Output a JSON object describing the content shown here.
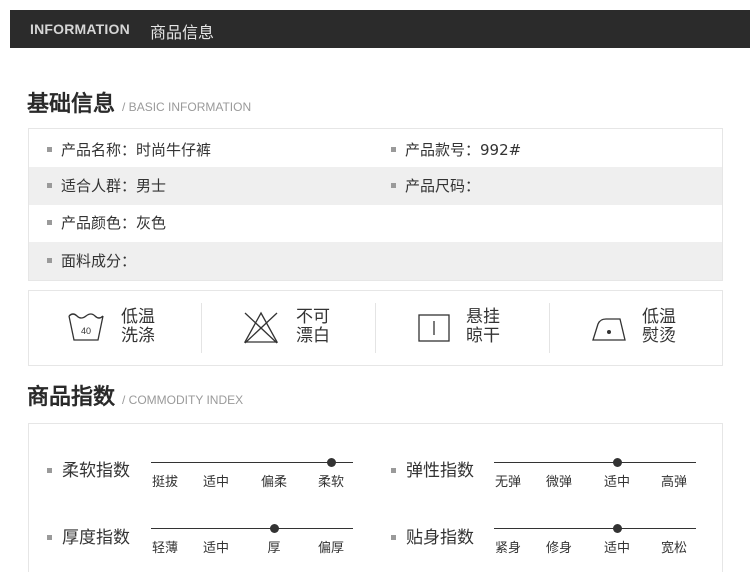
{
  "header": {
    "title_en": "INFORMATION",
    "title_cn": "商品信息"
  },
  "basic_section": {
    "title_cn": "基础信息",
    "title_en": "/ BASIC INFORMATION"
  },
  "basic_info": [
    {
      "left": "产品名称：时尚牛仔裤",
      "right": "产品款号：992#"
    },
    {
      "left": "适合人群：男士",
      "right": "产品尺码："
    },
    {
      "left": "产品颜色：灰色",
      "right": ""
    },
    {
      "left": "面料成分：",
      "right": ""
    }
  ],
  "care": [
    {
      "icon": "wash-40-icon",
      "icon_text": "40",
      "line1": "低温",
      "line2": "洗涤"
    },
    {
      "icon": "no-bleach-icon",
      "line1": "不可",
      "line2": "漂白"
    },
    {
      "icon": "hang-dry-icon",
      "line1": "悬挂",
      "line2": "晾干"
    },
    {
      "icon": "iron-low-icon",
      "line1": "低温",
      "line2": "熨烫"
    }
  ],
  "index_section": {
    "title_cn": "商品指数",
    "title_en": "/ COMMODITY INDEX"
  },
  "indices": [
    {
      "label": "柔软指数",
      "ticks": [
        "挺拔",
        "适中",
        "偏柔",
        "柔软"
      ],
      "selected": "柔软"
    },
    {
      "label": "弹性指数",
      "ticks": [
        "无弹",
        "微弹",
        "适中",
        "高弹"
      ],
      "selected": "适中"
    },
    {
      "label": "厚度指数",
      "ticks": [
        "轻薄",
        "适中",
        "厚",
        "偏厚"
      ],
      "selected": "厚"
    },
    {
      "label": "贴身指数",
      "ticks": [
        "紧身",
        "修身",
        "适中",
        "宽松"
      ],
      "selected": "适中"
    }
  ],
  "colors": {
    "header_bg": "#2b2b2b",
    "row_shade": "#efefef",
    "ink": "#333333"
  }
}
